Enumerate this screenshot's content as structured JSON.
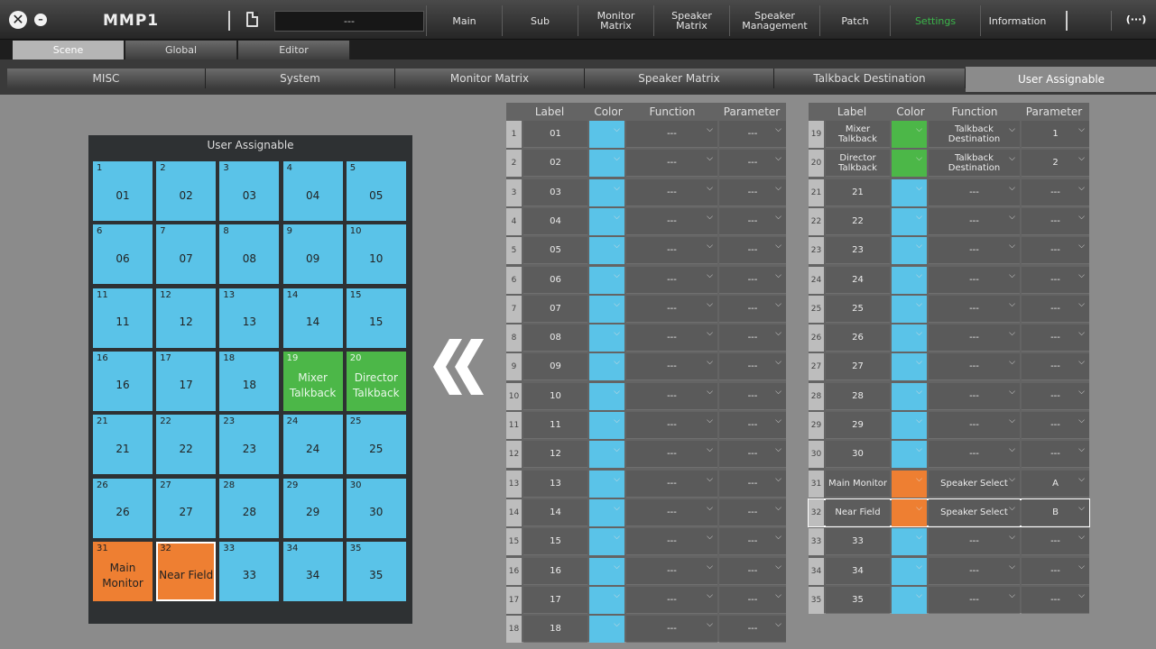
{
  "app": {
    "name": "MMP1",
    "scene_display": "---"
  },
  "nav": [
    "Main",
    "Sub",
    "Monitor\nMatrix",
    "Speaker\nMatrix",
    "Speaker\nManagement",
    "Patch",
    "Settings",
    "Information"
  ],
  "nav_active": "Settings",
  "tabs_level1": [
    "Scene",
    "Global",
    "Editor"
  ],
  "tabs_level1_selected": "Scene",
  "tabs_level2": [
    "MISC",
    "System",
    "Monitor Matrix",
    "Speaker Matrix",
    "Talkback Destination",
    "User Assignable"
  ],
  "tabs_level2_selected": "User Assignable",
  "panel_title": "User Assignable",
  "colors": {
    "blue": "#5ac3e8",
    "green": "#4cb748",
    "orange": "#ee7f32",
    "active_nav": "#3bb54a"
  },
  "table_headers": {
    "label": "Label",
    "color": "Color",
    "function": "Function",
    "parameter": "Parameter"
  },
  "keys": [
    {
      "n": "1",
      "label": "01",
      "color": "blue",
      "function": "---",
      "parameter": "---"
    },
    {
      "n": "2",
      "label": "02",
      "color": "blue",
      "function": "---",
      "parameter": "---"
    },
    {
      "n": "3",
      "label": "03",
      "color": "blue",
      "function": "---",
      "parameter": "---"
    },
    {
      "n": "4",
      "label": "04",
      "color": "blue",
      "function": "---",
      "parameter": "---"
    },
    {
      "n": "5",
      "label": "05",
      "color": "blue",
      "function": "---",
      "parameter": "---"
    },
    {
      "n": "6",
      "label": "06",
      "color": "blue",
      "function": "---",
      "parameter": "---"
    },
    {
      "n": "7",
      "label": "07",
      "color": "blue",
      "function": "---",
      "parameter": "---"
    },
    {
      "n": "8",
      "label": "08",
      "color": "blue",
      "function": "---",
      "parameter": "---"
    },
    {
      "n": "9",
      "label": "09",
      "color": "blue",
      "function": "---",
      "parameter": "---"
    },
    {
      "n": "10",
      "label": "10",
      "color": "blue",
      "function": "---",
      "parameter": "---"
    },
    {
      "n": "11",
      "label": "11",
      "color": "blue",
      "function": "---",
      "parameter": "---"
    },
    {
      "n": "12",
      "label": "12",
      "color": "blue",
      "function": "---",
      "parameter": "---"
    },
    {
      "n": "13",
      "label": "13",
      "color": "blue",
      "function": "---",
      "parameter": "---"
    },
    {
      "n": "14",
      "label": "14",
      "color": "blue",
      "function": "---",
      "parameter": "---"
    },
    {
      "n": "15",
      "label": "15",
      "color": "blue",
      "function": "---",
      "parameter": "---"
    },
    {
      "n": "16",
      "label": "16",
      "color": "blue",
      "function": "---",
      "parameter": "---"
    },
    {
      "n": "17",
      "label": "17",
      "color": "blue",
      "function": "---",
      "parameter": "---"
    },
    {
      "n": "18",
      "label": "18",
      "color": "blue",
      "function": "---",
      "parameter": "---"
    },
    {
      "n": "19",
      "label": "Mixer Talkback",
      "color": "green",
      "function": "Talkback Destination",
      "parameter": "1"
    },
    {
      "n": "20",
      "label": "Director Talkback",
      "color": "green",
      "function": "Talkback Destination",
      "parameter": "2"
    },
    {
      "n": "21",
      "label": "21",
      "color": "blue",
      "function": "---",
      "parameter": "---"
    },
    {
      "n": "22",
      "label": "22",
      "color": "blue",
      "function": "---",
      "parameter": "---"
    },
    {
      "n": "23",
      "label": "23",
      "color": "blue",
      "function": "---",
      "parameter": "---"
    },
    {
      "n": "24",
      "label": "24",
      "color": "blue",
      "function": "---",
      "parameter": "---"
    },
    {
      "n": "25",
      "label": "25",
      "color": "blue",
      "function": "---",
      "parameter": "---"
    },
    {
      "n": "26",
      "label": "26",
      "color": "blue",
      "function": "---",
      "parameter": "---"
    },
    {
      "n": "27",
      "label": "27",
      "color": "blue",
      "function": "---",
      "parameter": "---"
    },
    {
      "n": "28",
      "label": "28",
      "color": "blue",
      "function": "---",
      "parameter": "---"
    },
    {
      "n": "29",
      "label": "29",
      "color": "blue",
      "function": "---",
      "parameter": "---"
    },
    {
      "n": "30",
      "label": "30",
      "color": "blue",
      "function": "---",
      "parameter": "---"
    },
    {
      "n": "31",
      "label": "Main Monitor",
      "color": "orange",
      "function": "Speaker Select",
      "parameter": "A"
    },
    {
      "n": "32",
      "label": "Near Field",
      "color": "orange",
      "function": "Speaker Select",
      "parameter": "B"
    },
    {
      "n": "33",
      "label": "33",
      "color": "blue",
      "function": "---",
      "parameter": "---"
    },
    {
      "n": "34",
      "label": "34",
      "color": "blue",
      "function": "---",
      "parameter": "---"
    },
    {
      "n": "35",
      "label": "35",
      "color": "blue",
      "function": "---",
      "parameter": "---"
    }
  ],
  "selected_key": "32"
}
